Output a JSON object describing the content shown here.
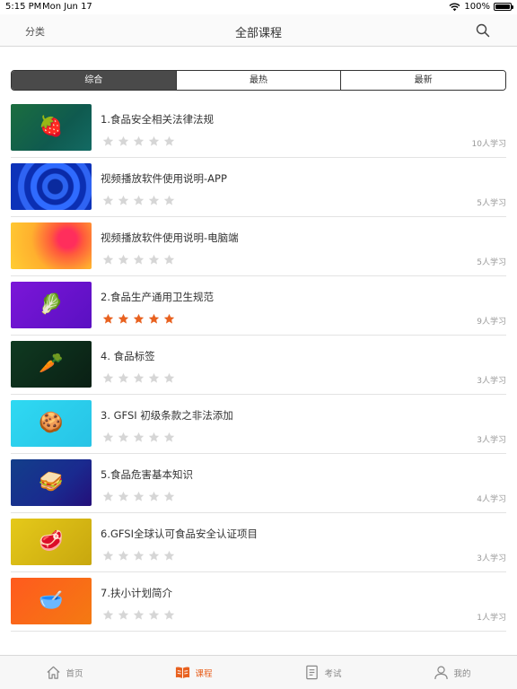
{
  "status": {
    "time": "5:15 PM",
    "date": "Mon Jun 17",
    "battery": "100%"
  },
  "nav": {
    "left": "分类",
    "title": "全部课程",
    "icon": "search-icon"
  },
  "segments": [
    {
      "label": "综合",
      "active": true
    },
    {
      "label": "最热",
      "active": false
    },
    {
      "label": "最新",
      "active": false
    }
  ],
  "courses": [
    {
      "title": "1.食品安全相关法律法规",
      "rating": 0,
      "learners": "10人学习",
      "thumb_icon": "strawberry-icon",
      "thumb_glyph": "🍓"
    },
    {
      "title": "视频播放软件使用说明-APP",
      "rating": 0,
      "learners": "5人学习",
      "thumb_icon": "abstract-rings-icon",
      "thumb_glyph": ""
    },
    {
      "title": "视频播放软件使用说明-电脑端",
      "rating": 0,
      "learners": "5人学习",
      "thumb_icon": "abstract-swirl-icon",
      "thumb_glyph": ""
    },
    {
      "title": "2.食品生产通用卫生规范",
      "rating": 5,
      "learners": "9人学习",
      "thumb_icon": "lettuce-icon",
      "thumb_glyph": "🥬"
    },
    {
      "title": "4. 食品标签",
      "rating": 0,
      "learners": "3人学习",
      "thumb_icon": "carrot-icon",
      "thumb_glyph": "🥕"
    },
    {
      "title": "3. GFSI 初级条款之非法添加",
      "rating": 0,
      "learners": "3人学习",
      "thumb_icon": "macaron-icon",
      "thumb_glyph": "🍪"
    },
    {
      "title": "5.食品危害基本知识",
      "rating": 0,
      "learners": "4人学习",
      "thumb_icon": "sandwich-icon",
      "thumb_glyph": "🥪"
    },
    {
      "title": "6.GFSI全球认可食品安全认证项目",
      "rating": 0,
      "learners": "3人学习",
      "thumb_icon": "meat-icon",
      "thumb_glyph": "🥩"
    },
    {
      "title": "7.扶小计划简介",
      "rating": 0,
      "learners": "1人学习",
      "thumb_icon": "cereal-bowl-icon",
      "thumb_glyph": "🥣"
    }
  ],
  "tabs": [
    {
      "label": "首页",
      "icon": "home-icon",
      "active": false
    },
    {
      "label": "课程",
      "icon": "book-icon",
      "active": true
    },
    {
      "label": "考试",
      "icon": "exam-icon",
      "active": false
    },
    {
      "label": "我的",
      "icon": "user-icon",
      "active": false
    }
  ],
  "colors": {
    "accent": "#e8611f",
    "star_active": "#e8611f",
    "star_inactive": "#d6d6d6"
  }
}
